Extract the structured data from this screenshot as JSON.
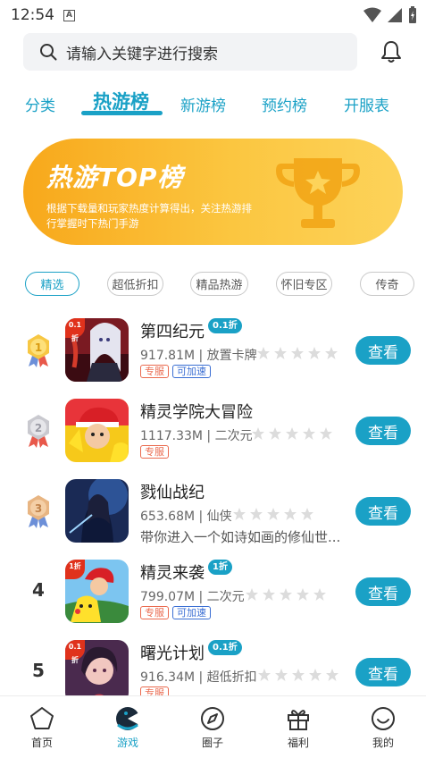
{
  "status_bar": {
    "time": "12:54",
    "indicator": "A"
  },
  "search": {
    "placeholder": "请输入关键字进行搜索"
  },
  "tabs": [
    {
      "label": "分类"
    },
    {
      "label": "热游榜"
    },
    {
      "label": "新游榜"
    },
    {
      "label": "预约榜"
    },
    {
      "label": "开服表"
    }
  ],
  "active_tab": "热游榜",
  "banner": {
    "title": "热游TOP榜",
    "description": "根据下载量和玩家热度计算得出，关注热游排行掌握时下热门手游"
  },
  "filters": [
    {
      "label": "精选"
    },
    {
      "label": "超低折扣"
    },
    {
      "label": "精品热游"
    },
    {
      "label": "怀旧专区"
    },
    {
      "label": "传奇"
    }
  ],
  "games": [
    {
      "rank": "1",
      "name": "第四纪元",
      "discount": "0.1折",
      "size": "917.81M",
      "genre": "放置卡牌",
      "meta": "917.81M | 放置卡牌",
      "tags": [
        "专服",
        "可加速"
      ],
      "icon_badge": "0.1折",
      "button": "查看"
    },
    {
      "rank": "2",
      "name": "精灵学院大冒险",
      "discount": "",
      "size": "1117.33M",
      "genre": "二次元",
      "meta": "1117.33M | 二次元",
      "tags": [
        "专服"
      ],
      "icon_badge": "",
      "button": "查看"
    },
    {
      "rank": "3",
      "name": "戮仙战纪",
      "discount": "",
      "size": "653.68M",
      "genre": "仙侠",
      "meta": "653.68M | 仙侠",
      "desc": "带你进入一个如诗如画的修仙世...",
      "icon_badge": "",
      "button": "查看"
    },
    {
      "rank": "4",
      "name": "精灵来袭",
      "discount": "1折",
      "size": "799.07M",
      "genre": "二次元",
      "meta": "799.07M | 二次元",
      "tags": [
        "专服",
        "可加速"
      ],
      "icon_badge": "1折",
      "button": "查看"
    },
    {
      "rank": "5",
      "name": "曙光计划",
      "discount": "0.1折",
      "size": "916.34M",
      "genre": "超低折扣",
      "meta": "916.34M | 超低折扣",
      "tags": [
        "专服"
      ],
      "icon_badge": "0.1折",
      "button": "查看"
    }
  ],
  "bottom_nav": [
    {
      "label": "首页",
      "icon": "home-pentagon-icon"
    },
    {
      "label": "游戏",
      "icon": "game-pacman-icon"
    },
    {
      "label": "圈子",
      "icon": "compass-icon"
    },
    {
      "label": "福利",
      "icon": "gift-icon"
    },
    {
      "label": "我的",
      "icon": "smiley-icon"
    }
  ],
  "colors": {
    "accent": "#1aa1c6",
    "banner_start": "#f8a81b",
    "banner_end": "#fdd35a"
  }
}
